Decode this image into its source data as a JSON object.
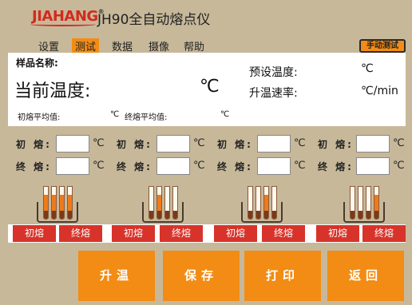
{
  "header": {
    "logo_text": "JIAHANG",
    "logo_reg": "®",
    "title": "JH90全自动熔点仪"
  },
  "menu": {
    "items": [
      "设置",
      "测试",
      "数据",
      "摄像",
      "帮助"
    ],
    "active_index": 1,
    "mode_button": "手动测试"
  },
  "info": {
    "sample_name_label": "样品名称:",
    "current_temp_label": "当前温度:",
    "current_temp_unit": "℃",
    "preset_temp_label": "预设温度:",
    "preset_temp_unit": "℃",
    "ramp_rate_label": "升温速率:",
    "ramp_rate_unit": "℃/min",
    "initial_avg_label": "初熔平均值:",
    "initial_avg_unit": "℃",
    "final_avg_label": "终熔平均值:",
    "final_avg_unit": "℃"
  },
  "channels": [
    {
      "initial_label": "初 熔:",
      "final_label": "终 熔:",
      "unit": "℃",
      "tag_initial": "初熔",
      "tag_final": "终熔",
      "selected_tube": 3
    },
    {
      "initial_label": "初 熔:",
      "final_label": "终 熔:",
      "unit": "℃",
      "tag_initial": "初熔",
      "tag_final": "终熔",
      "selected_tube": 1
    },
    {
      "initial_label": "初 熔:",
      "final_label": "终 熔:",
      "unit": "℃",
      "tag_initial": "初熔",
      "tag_final": "终熔",
      "selected_tube": 2
    },
    {
      "initial_label": "初 熔:",
      "final_label": "终 熔:",
      "unit": "℃",
      "tag_initial": "初熔",
      "tag_final": "终熔",
      "selected_tube": 3
    }
  ],
  "actions": {
    "heat": "升温",
    "save": "保存",
    "print": "打印",
    "back": "返回"
  },
  "colors": {
    "accent": "#f28c14",
    "tag_red": "#d8332a",
    "background": "#c7b89a"
  }
}
